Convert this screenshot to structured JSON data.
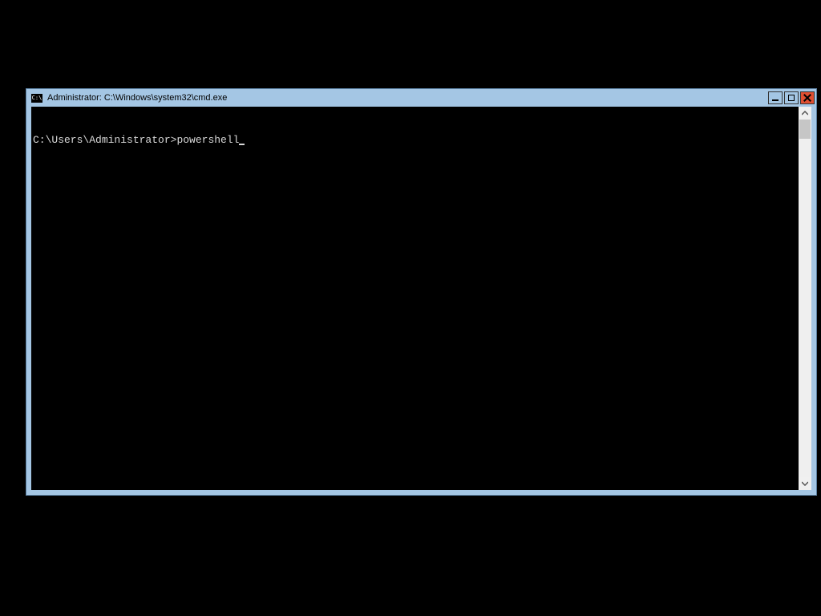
{
  "window": {
    "title": "Administrator: C:\\Windows\\system32\\cmd.exe",
    "icon_label": "C:\\"
  },
  "terminal": {
    "prompt": "C:\\Users\\Administrator>",
    "input": "powershell"
  }
}
